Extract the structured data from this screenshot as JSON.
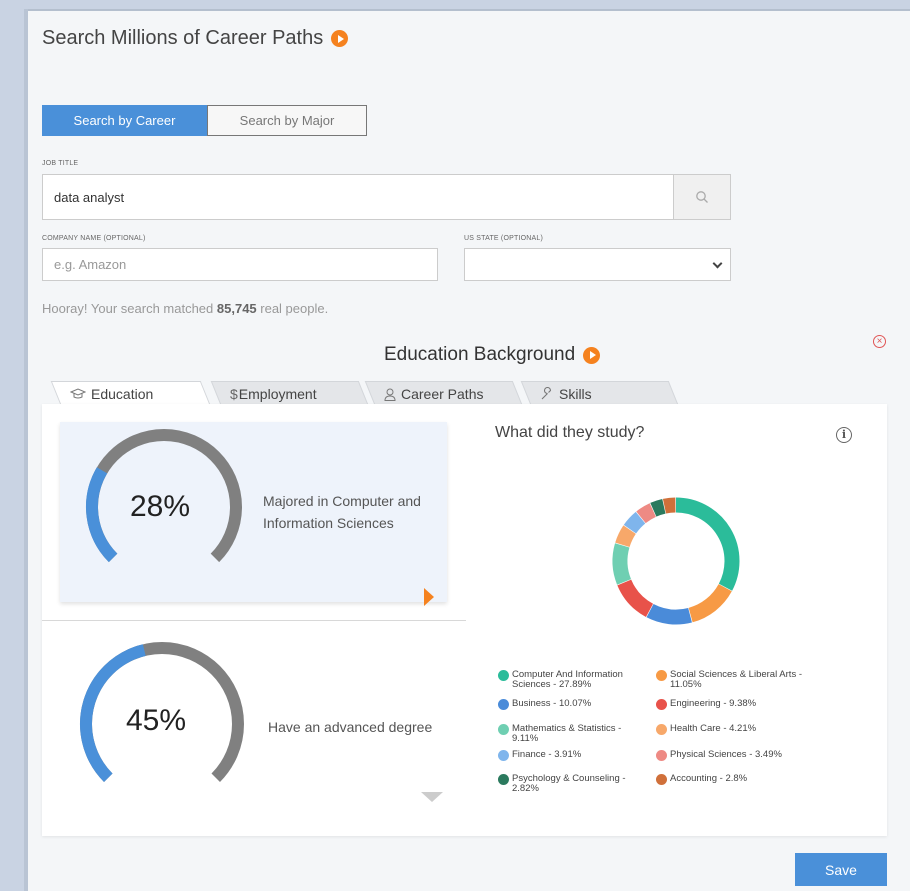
{
  "title": "Search Millions of Career Paths",
  "search_mode": {
    "career": "Search by Career",
    "major": "Search by Major"
  },
  "job_title": {
    "label": "JOB TITLE",
    "value": "data analyst"
  },
  "company": {
    "label": "COMPANY NAME (OPTIONAL)",
    "placeholder": "e.g. Amazon"
  },
  "state": {
    "label": "US STATE (OPTIONAL)",
    "value": ""
  },
  "result": {
    "prefix": "Hooray! Your search matched ",
    "count": "85,745",
    "suffix": " real people."
  },
  "section_title": "Education Background",
  "tabs": [
    {
      "label": "Education",
      "icon": "graduation-cap-icon"
    },
    {
      "label": "Employment",
      "icon": "dollar-icon"
    },
    {
      "label": "Career Paths",
      "icon": "person-icon"
    },
    {
      "label": "Skills",
      "icon": "wrench-icon"
    }
  ],
  "stats": [
    {
      "percent": "28%",
      "value": 0.28,
      "desc": "Majored in Computer and Information Sciences"
    },
    {
      "percent": "45%",
      "value": 0.45,
      "desc": "Have an advanced degree"
    }
  ],
  "study_title": "What did they study?",
  "chart_data": {
    "type": "pie",
    "donut": true,
    "slices": [
      {
        "label": "Computer And Information Sciences - 27.89%",
        "value": 27.89,
        "color": "#2bbc9a"
      },
      {
        "label": "Social Sciences & Liberal Arts - 11.05%",
        "value": 11.05,
        "color": "#f79a45"
      },
      {
        "label": "Business - 10.07%",
        "value": 10.07,
        "color": "#4a8bd9"
      },
      {
        "label": "Engineering - 9.38%",
        "value": 9.38,
        "color": "#e8524a"
      },
      {
        "label": "Mathematics & Statistics - 9.11%",
        "value": 9.11,
        "color": "#6fcfb2"
      },
      {
        "label": "Health Care - 4.21%",
        "value": 4.21,
        "color": "#f7a86a"
      },
      {
        "label": "Finance - 3.91%",
        "value": 3.91,
        "color": "#7fb5ec"
      },
      {
        "label": "Physical Sciences - 3.49%",
        "value": 3.49,
        "color": "#ee8a84"
      },
      {
        "label": "Psychology & Counseling - 2.82%",
        "value": 2.82,
        "color": "#2b7a5e"
      },
      {
        "label": "Accounting - 2.8%",
        "value": 2.8,
        "color": "#d0703a"
      }
    ]
  },
  "colors": {
    "accent": "#4a90d9",
    "orange": "#f5821f",
    "gauge_fill": "#4a90d9",
    "gauge_rest": "#808080"
  },
  "save_label": "Save"
}
